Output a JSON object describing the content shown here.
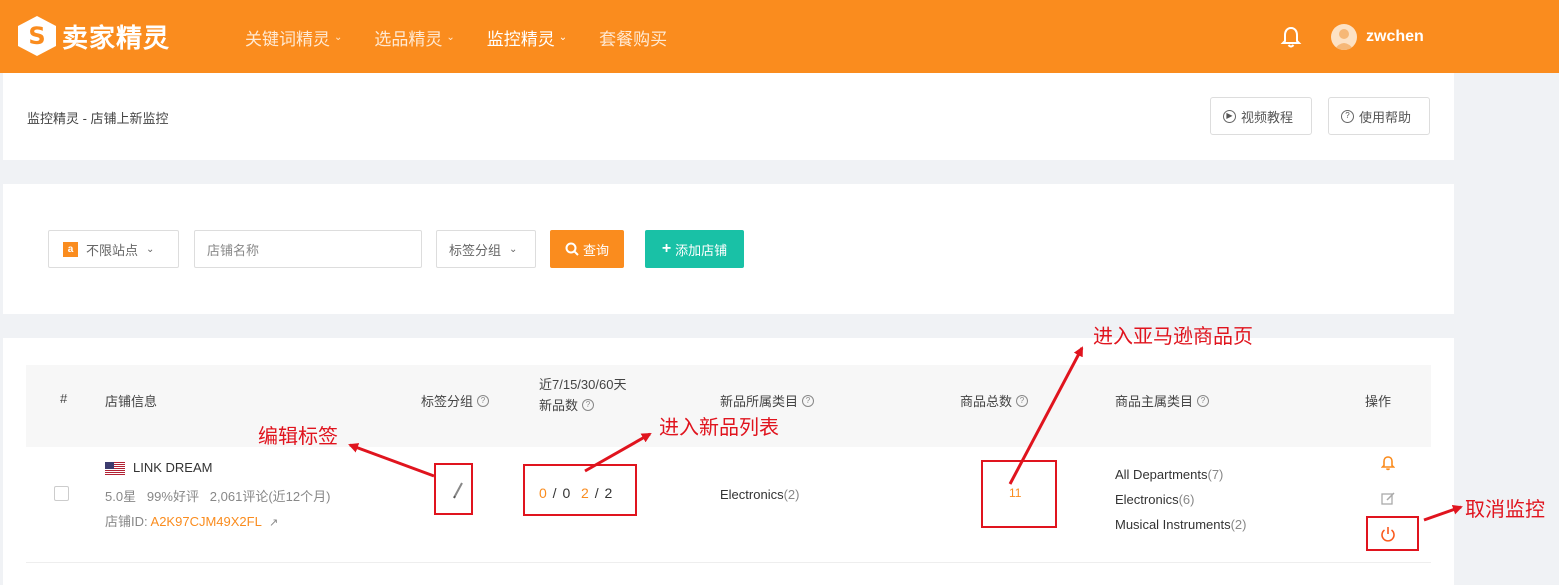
{
  "header": {
    "logo_text": "卖家精灵",
    "logo_letter": "S",
    "nav": [
      {
        "label": "关键词精灵",
        "chevron": "⌄"
      },
      {
        "label": "选品精灵",
        "chevron": "⌄"
      },
      {
        "label": "监控精灵",
        "chevron": "⌄"
      },
      {
        "label": "套餐购买"
      }
    ],
    "active_nav": "监控精灵",
    "username": "zwchen",
    "brand_color": "#fa8c1e"
  },
  "page": {
    "breadcrumb": "监控精灵 - 店铺上新监控",
    "video_tutorial": "视频教程",
    "help": "使用帮助"
  },
  "filters": {
    "site_select": "不限站点",
    "site_icon": "a",
    "store_name_placeholder": "店铺名称",
    "tag_group_select": "标签分组",
    "query_button": "查询",
    "add_store_button": "添加店铺",
    "accent_teal": "#19c1a6"
  },
  "table": {
    "headers": {
      "index": "#",
      "store_info": "店铺信息",
      "tag_group": "标签分组",
      "new_count_line1": "近7/15/30/60天",
      "new_count_line2": "新品数",
      "new_category": "新品所属类目",
      "total_products": "商品总数",
      "main_category": "商品主属类目",
      "actions": "操作"
    },
    "rows": [
      {
        "store_name": "LINK DREAM",
        "rating": "5.0星",
        "positive": "99%好评",
        "reviews": "2,061评论(近12个月)",
        "store_id_label": "店铺ID:",
        "store_id": "A2K97CJM49X2FL",
        "new_counts": [
          "0",
          "0",
          "2",
          "2"
        ],
        "new_category": {
          "name": "Electronics",
          "count": "(2)"
        },
        "total_products": "11",
        "main_categories": [
          {
            "name": "All Departments",
            "count": "(7)"
          },
          {
            "name": "Electronics",
            "count": "(6)"
          },
          {
            "name": "Musical Instruments",
            "count": "(2)"
          }
        ]
      }
    ]
  },
  "annotations": {
    "edit_tag": "编辑标签",
    "new_list": "进入新品列表",
    "amazon_page": "进入亚马逊商品页",
    "cancel_monitor": "取消监控",
    "color": "#e0141e"
  }
}
